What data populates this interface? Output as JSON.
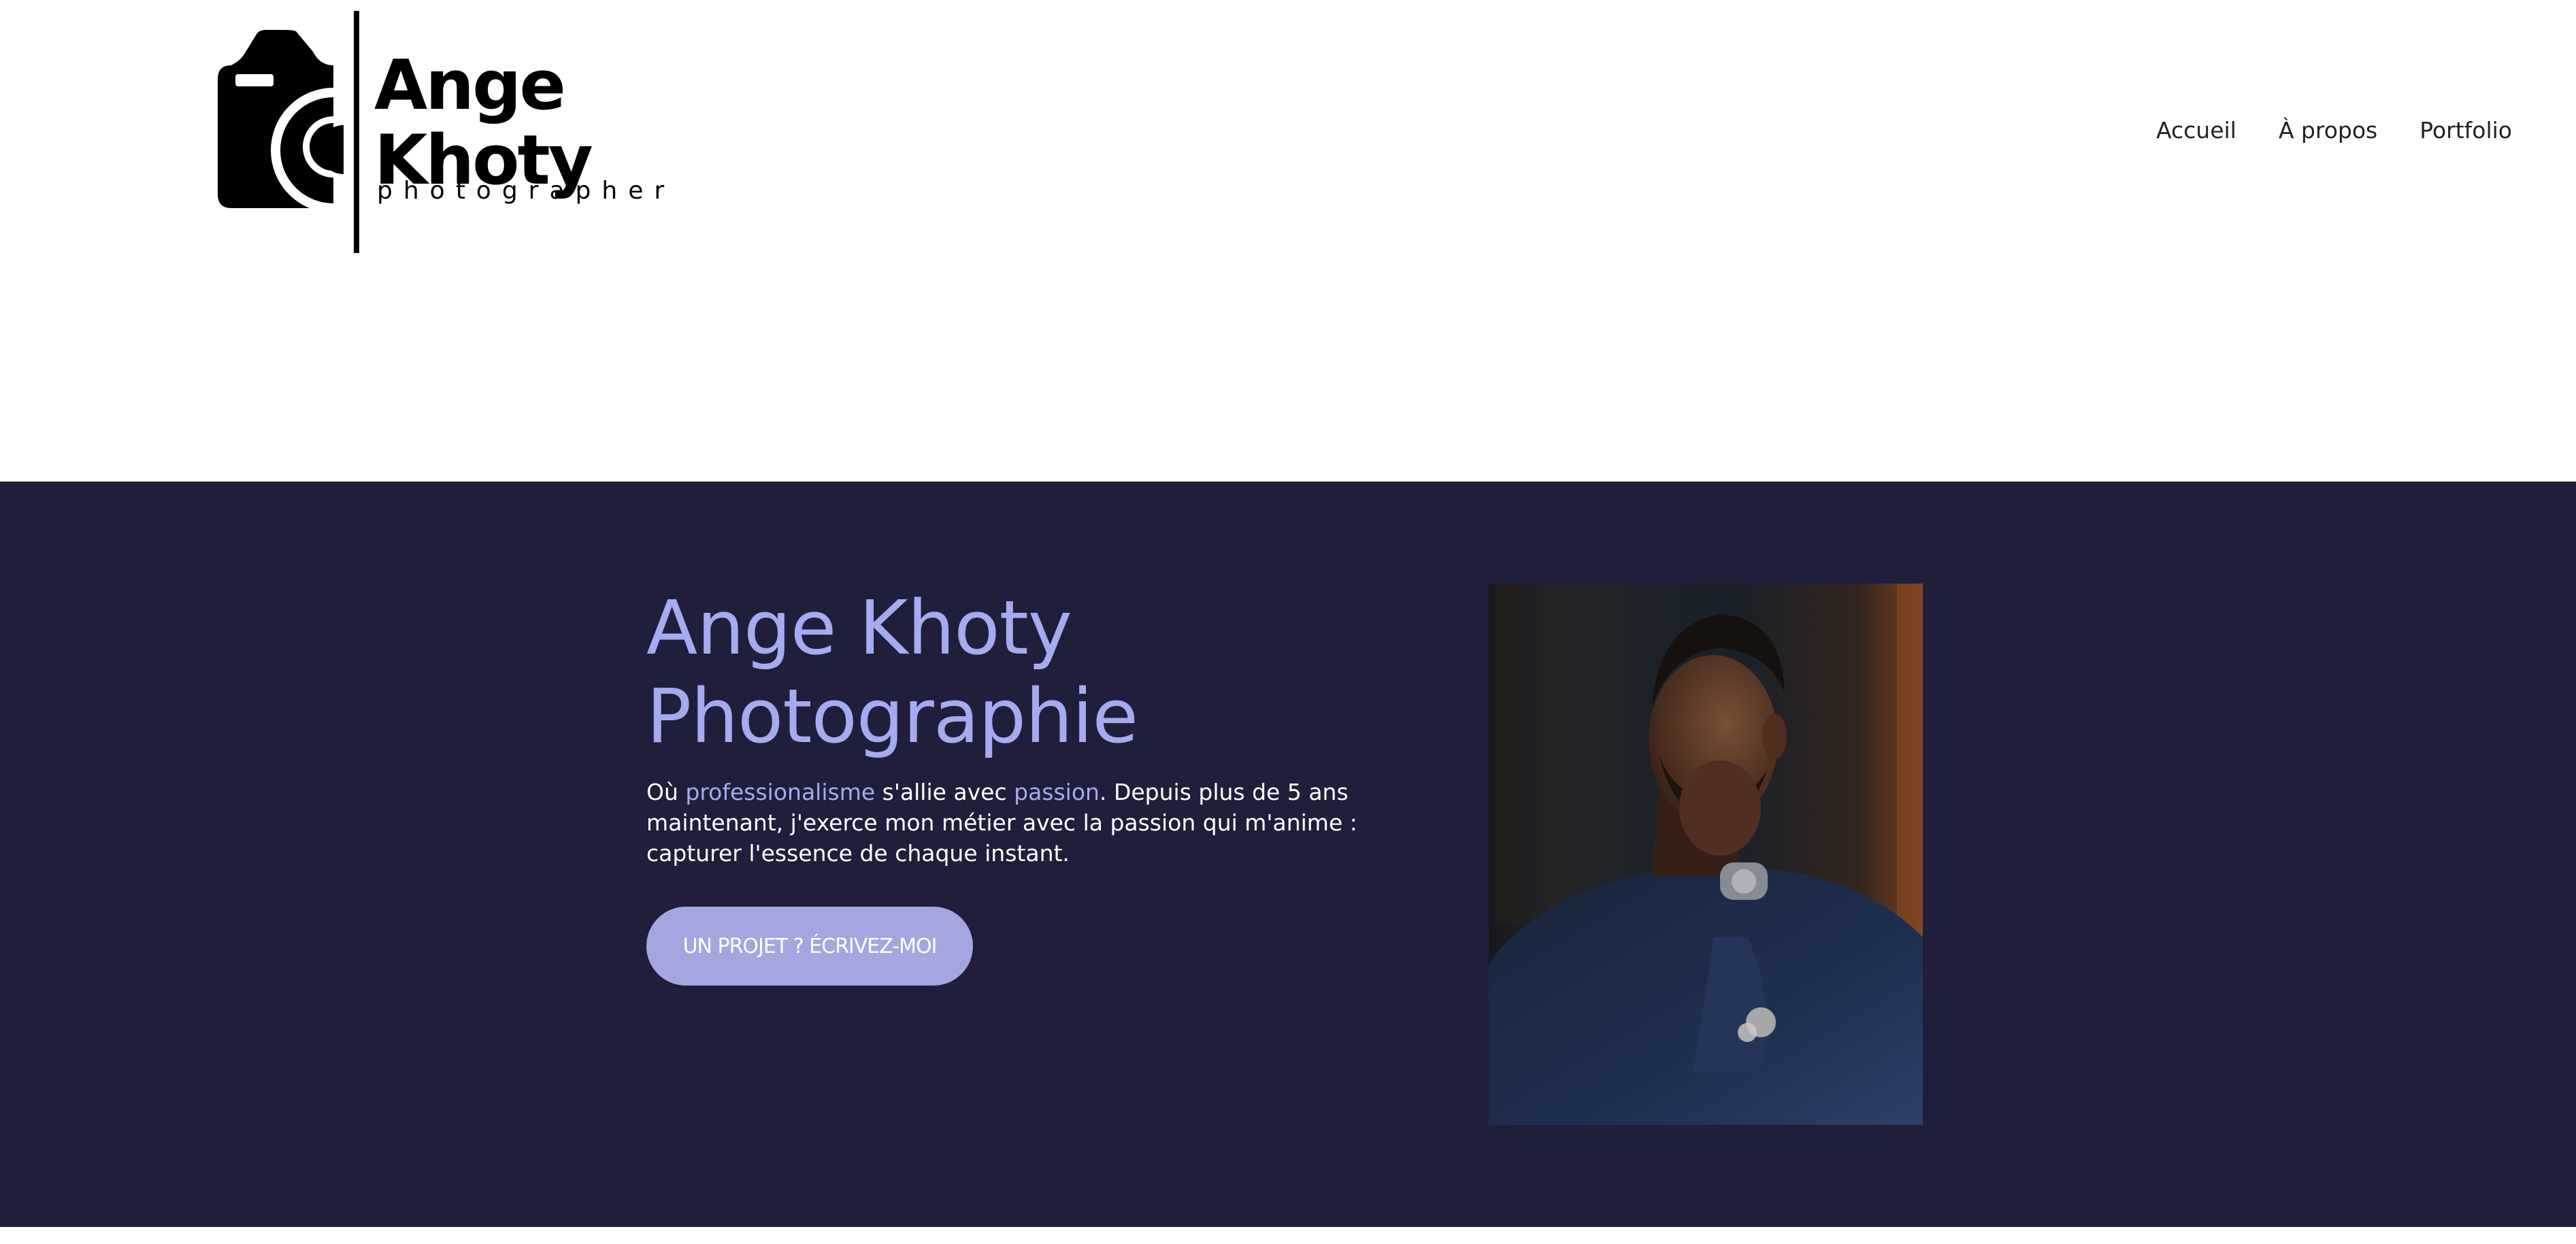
{
  "header": {
    "logo": {
      "name": "Ange\nKhoty",
      "tagline": "photographer",
      "icon": "camera-logo-icon"
    },
    "nav": {
      "items": [
        "Accueil",
        "À propos",
        "Portfolio"
      ]
    }
  },
  "hero": {
    "title": "Ange Khoty Photographie",
    "text": {
      "part1": "Où ",
      "highlight1": "professionalisme",
      "part2": " s'allie avec ",
      "highlight2": "passion",
      "part3": ". Depuis plus de 5 ans maintenant, j'exerce mon métier avec la passion qui m'anime : capturer l'essence de chaque instant."
    },
    "cta_label": "UN PROJET ? ÉCRIVEZ-MOI",
    "photo": "portrait-photo"
  },
  "colors": {
    "hero_background": "#1f1f3b",
    "accent": "#a4abf0",
    "button": "#a4a6e0",
    "text_light": "#ffffff",
    "nav_text": "#222222"
  }
}
